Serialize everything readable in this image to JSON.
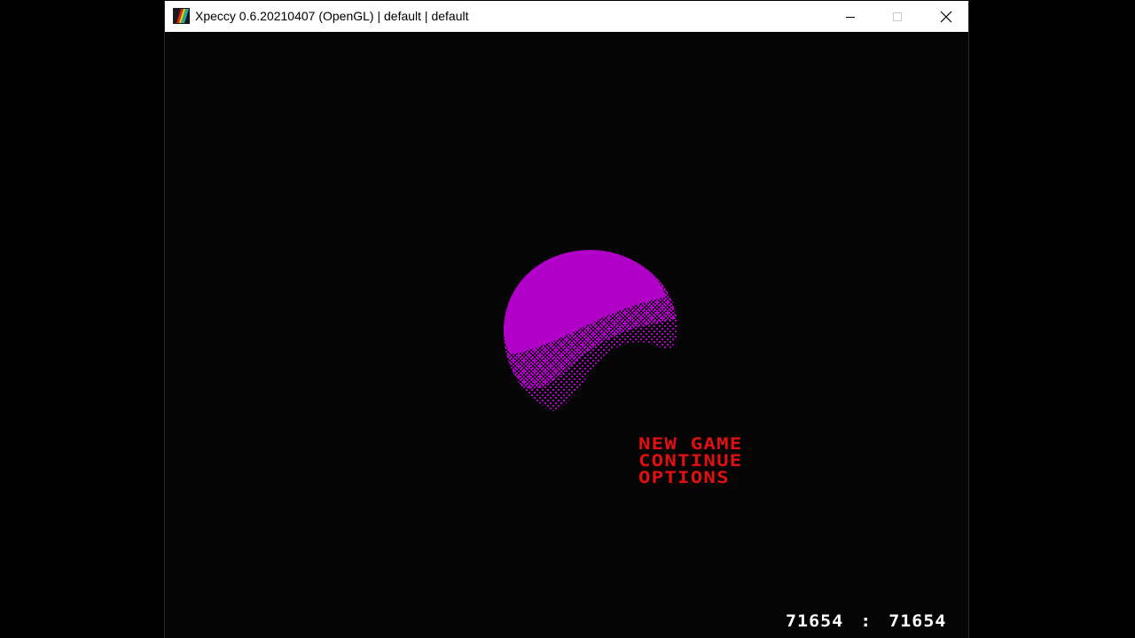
{
  "window": {
    "title": "Xpeccy 0.6.20210407 (OpenGL) | default | default",
    "app_icon": "xpeccy-rainbow-icon",
    "controls": {
      "minimize_icon": "minimize-icon",
      "maximize_icon": "maximize-icon",
      "close_icon": "close-icon"
    }
  },
  "game": {
    "planet_color": "#b000c8",
    "menu_color": "#e01010",
    "menu": [
      "NEW GAME",
      "CONTINUE",
      "OPTIONS"
    ],
    "counter": {
      "left": "71654",
      "separator": ":",
      "right": "71654"
    }
  }
}
